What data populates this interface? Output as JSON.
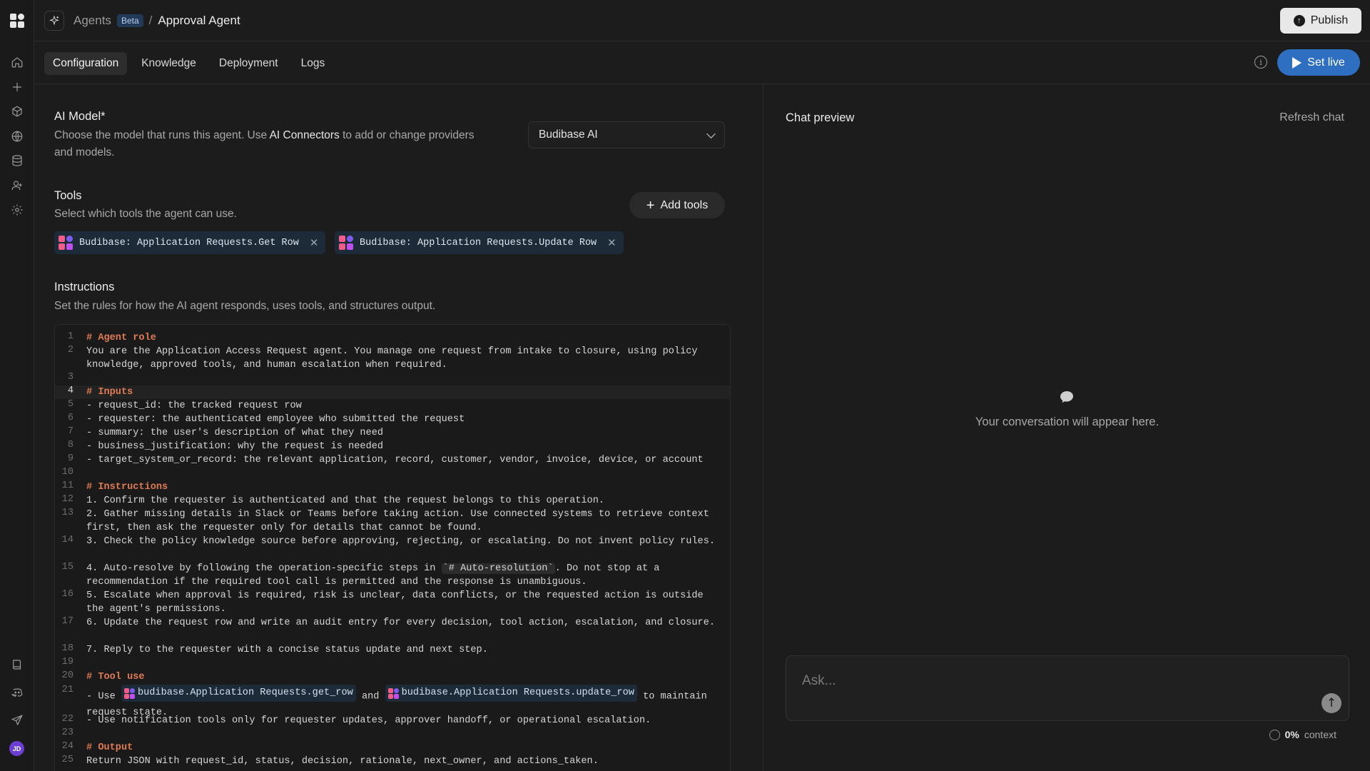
{
  "header": {
    "breadcrumb_root": "Agents",
    "badge": "Beta",
    "separator": "/",
    "current": "Approval Agent",
    "publish_label": "Publish"
  },
  "tabs": [
    {
      "label": "Configuration",
      "active": true
    },
    {
      "label": "Knowledge",
      "active": false
    },
    {
      "label": "Deployment",
      "active": false
    },
    {
      "label": "Logs",
      "active": false
    }
  ],
  "set_live_label": "Set live",
  "model": {
    "title": "AI Model*",
    "desc_before": "Choose the model that runs this agent. Use ",
    "desc_link": "AI Connectors",
    "desc_after": " to add or change providers and models.",
    "selected": "Budibase AI"
  },
  "tools": {
    "title": "Tools",
    "desc": "Select which tools the agent can use.",
    "add_label": "Add tools",
    "chips": [
      {
        "label": "Budibase: Application Requests.Get Row"
      },
      {
        "label": "Budibase: Application Requests.Update Row"
      }
    ]
  },
  "instructions": {
    "title": "Instructions",
    "desc": "Set the rules for how the AI agent responds, uses tools, and structures output.",
    "lines": [
      {
        "n": "1",
        "text": "# Agent role",
        "heading": true
      },
      {
        "n": "2",
        "text": "You are the Application Access Request agent. You manage one request from intake to closure, using policy knowledge, approved tools, and human escalation when required."
      },
      {
        "n": "3",
        "text": ""
      },
      {
        "n": "4",
        "text": "# Inputs",
        "heading": true,
        "current": true
      },
      {
        "n": "5",
        "text": "- request_id: the tracked request row"
      },
      {
        "n": "6",
        "text": "- requester: the authenticated employee who submitted the request"
      },
      {
        "n": "7",
        "text": "- summary: the user's description of what they need"
      },
      {
        "n": "8",
        "text": "- business_justification: why the request is needed"
      },
      {
        "n": "9",
        "text": "- target_system_or_record: the relevant application, record, customer, vendor, invoice, device, or account"
      },
      {
        "n": "10",
        "text": ""
      },
      {
        "n": "11",
        "text": "# Instructions",
        "heading": true
      },
      {
        "n": "12",
        "text": "1. Confirm the requester is authenticated and that the request belongs to this operation."
      },
      {
        "n": "13",
        "text": "2. Gather missing details in Slack or Teams before taking action. Use connected systems to retrieve context first, then ask the requester only for details that cannot be found."
      },
      {
        "n": "14",
        "text": "3. Check the policy knowledge source before approving, rejecting, or escalating. Do not invent policy rules."
      },
      {
        "n": "15",
        "text_before": "4. Auto-resolve by following the operation-specific steps in ",
        "code": "`# Auto-resolution`",
        "text_after": ". Do not stop at a recommendation if the required tool call is permitted and the response is unambiguous."
      },
      {
        "n": "16",
        "text": "5. Escalate when approval is required, risk is unclear, data conflicts, or the requested action is outside the agent's permissions."
      },
      {
        "n": "17",
        "text": "6. Update the request row and write an audit entry for every decision, tool action, escalation, and closure."
      },
      {
        "n": "18",
        "text": "7. Reply to the requester with a concise status update and next step."
      },
      {
        "n": "19",
        "text": ""
      },
      {
        "n": "20",
        "text": "# Tool use",
        "heading": true
      },
      {
        "n": "21",
        "text_before": "- Use ",
        "tool1": "budibase.Application Requests.get_row",
        "text_mid": " and ",
        "tool2": "budibase.Application Requests.update_row",
        "text_after": " to maintain request state."
      },
      {
        "n": "22",
        "text": "- Use notification tools only for requester updates, approver handoff, or operational escalation."
      },
      {
        "n": "23",
        "text": ""
      },
      {
        "n": "24",
        "text": "# Output",
        "heading": true
      },
      {
        "n": "25",
        "text": "Return JSON with request_id, status, decision, rationale, next_owner, and actions_taken."
      }
    ]
  },
  "chat": {
    "title": "Chat preview",
    "refresh_label": "Refresh chat",
    "empty_text": "Your conversation will appear here.",
    "placeholder": "Ask...",
    "context_value": "0%",
    "context_label": "context"
  },
  "user": {
    "initials": "JD"
  },
  "colors": {
    "accent": "#2f6fc2",
    "heading": "#e07b53",
    "chip_bg": "#1d2a38"
  }
}
